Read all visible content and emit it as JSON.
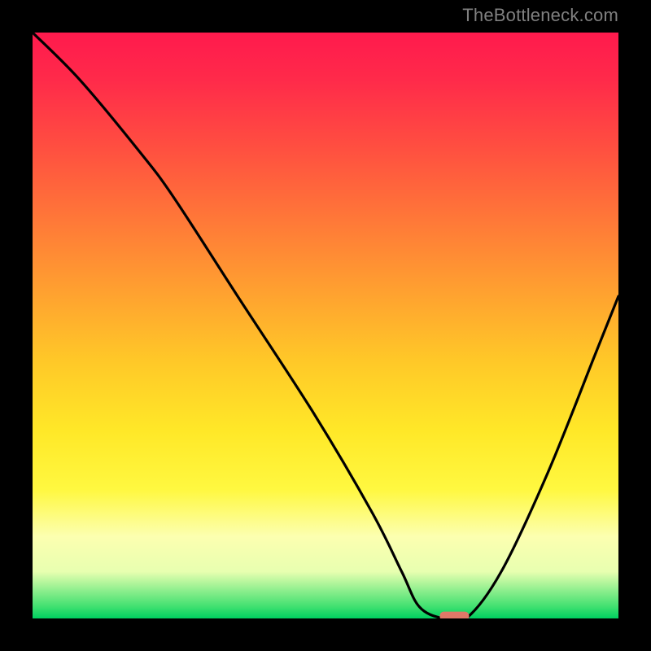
{
  "watermark": "TheBottleneck.com",
  "chart_data": {
    "type": "line",
    "title": "",
    "xlabel": "",
    "ylabel": "",
    "xlim": [
      0,
      100
    ],
    "ylim": [
      0,
      100
    ],
    "grid": false,
    "legend": false,
    "series": [
      {
        "name": "curve",
        "x": [
          0,
          8,
          18,
          24,
          35,
          48,
          58,
          63,
          66,
          70,
          74,
          80,
          88,
          96,
          100
        ],
        "values": [
          100,
          92,
          80,
          72,
          55,
          35,
          18,
          8,
          2,
          0,
          0,
          8,
          25,
          45,
          55
        ]
      }
    ],
    "marker": {
      "x": 72,
      "y": 0,
      "width": 5,
      "height": 1.5,
      "color": "#e07868"
    },
    "background_gradient": {
      "direction": "vertical",
      "stops": [
        {
          "pos": 0,
          "color": "#ff1a4d"
        },
        {
          "pos": 20,
          "color": "#ff5040"
        },
        {
          "pos": 44,
          "color": "#ffa030"
        },
        {
          "pos": 68,
          "color": "#ffe828"
        },
        {
          "pos": 86,
          "color": "#fcffb0"
        },
        {
          "pos": 100,
          "color": "#00d060"
        }
      ]
    }
  }
}
